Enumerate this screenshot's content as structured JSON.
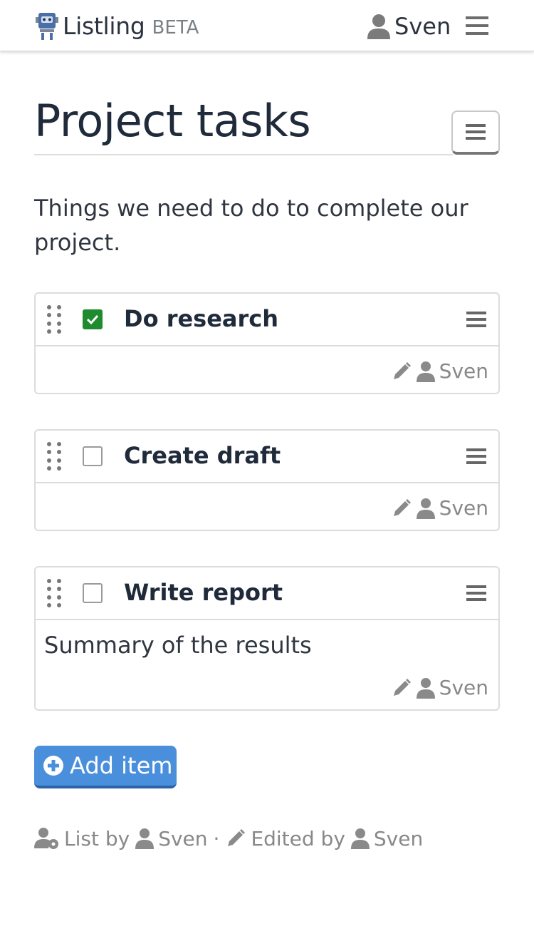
{
  "header": {
    "app_name": "Listling",
    "badge": "BETA",
    "user_name": "Sven",
    "logo_icon": "listling-robot-logo",
    "menu_icon": "hamburger-icon"
  },
  "list": {
    "title": "Project tasks",
    "description": "Things we need to do to complete our project.",
    "items": [
      {
        "title": "Do research",
        "checked": true,
        "note": "",
        "author": "Sven"
      },
      {
        "title": "Create draft",
        "checked": false,
        "note": "",
        "author": "Sven"
      },
      {
        "title": "Write report",
        "checked": false,
        "note": "Summary of the results",
        "author": "Sven"
      }
    ],
    "add_label": "Add item"
  },
  "footer": {
    "list_by_label": "List by",
    "list_by_user": "Sven",
    "separator": "·",
    "edited_by_label": "Edited by",
    "edited_by_user": "Sven"
  },
  "colors": {
    "accent": "#4a8fdc",
    "check_green": "#1e8c2e",
    "muted": "#888888"
  }
}
